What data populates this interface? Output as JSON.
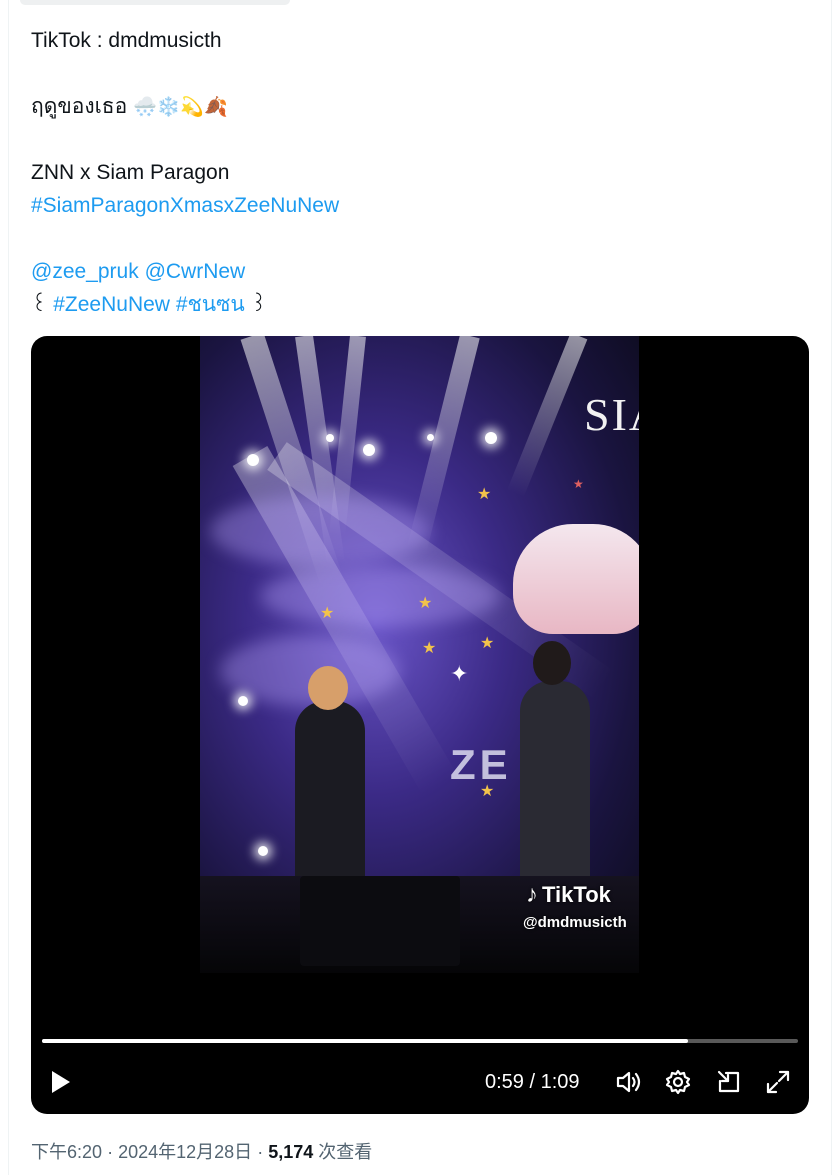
{
  "tweet": {
    "line1": "TikTok : dmdmusicth",
    "line2_text": "ฤดูของเธอ",
    "line2_emoji": "🌨️❄️💫🍂",
    "line3": "ZNN x Siam Paragon",
    "hashtag1": "#SiamParagonXmasxZeeNuNew",
    "mention1": "@zee_pruk",
    "mention2": "@CwrNew",
    "bracket_open": "꒰",
    "hashtag2": "#ZeeNuNew",
    "hashtag3": "#ชนซน",
    "bracket_close": "꒱"
  },
  "video": {
    "overlay_siam": "SIA",
    "overlay_ze": "ZE PR",
    "watermark_brand": "TikTok",
    "watermark_handle": "@dmdmusicth",
    "progress": 0.855,
    "time_display": "0:59 / 1:09",
    "icons": {
      "play": "play-icon",
      "volume": "volume-icon",
      "settings": "gear-icon",
      "dock": "dock-icon",
      "fullscreen": "fullscreen-icon"
    }
  },
  "meta": {
    "time": "下午6:20",
    "sep1": "·",
    "date": "2024年12月28日",
    "sep2": "·",
    "views_count": "5,174",
    "views_label": "次查看"
  },
  "colors": {
    "link": "#1d9bf0",
    "meta": "#536471",
    "text": "#0f1419"
  }
}
